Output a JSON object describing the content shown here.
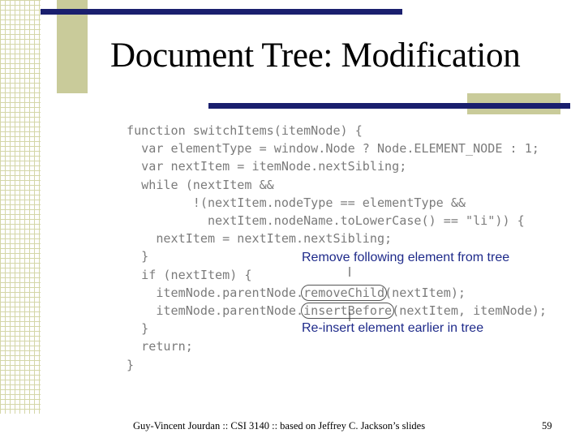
{
  "slide": {
    "title": "Document Tree: Modification",
    "code_lines": [
      [
        "function switchItems(itemNode) {"
      ],
      [
        "  var elementType = window.Node ? Node.ELEMENT_NODE : 1;"
      ],
      [
        "  var nextItem = itemNode.nextSibling;"
      ],
      [
        "  while (nextItem &&"
      ],
      [
        "         !(nextItem.nodeType == elementType &&"
      ],
      [
        "           nextItem.nodeName.toLowerCase() == \"li\")) {"
      ],
      [
        "    nextItem = nextItem.nextSibling;"
      ],
      [
        "  }"
      ],
      [
        "  if (nextItem) {"
      ],
      [
        "    itemNode.parentNode.",
        "removeChild",
        "(nextItem);"
      ],
      [
        "    itemNode.parentNode.",
        "insertBefore",
        "(nextItem, itemNode);"
      ],
      [
        "  }"
      ],
      [
        "  return;"
      ],
      [
        "}"
      ]
    ],
    "callouts": {
      "remove": "Remove following element from tree",
      "reinsert": "Re-insert element earlier in tree"
    },
    "footer": "Guy-Vincent Jourdan :: CSI 3140 :: based on Jeffrey C. Jackson’s slides",
    "page_number": "59"
  },
  "colors": {
    "rule": "#1a1f6e",
    "accent_block": "#c9cb9a",
    "callout_text": "#1e2a8a",
    "code_text": "#7b7b7b"
  }
}
